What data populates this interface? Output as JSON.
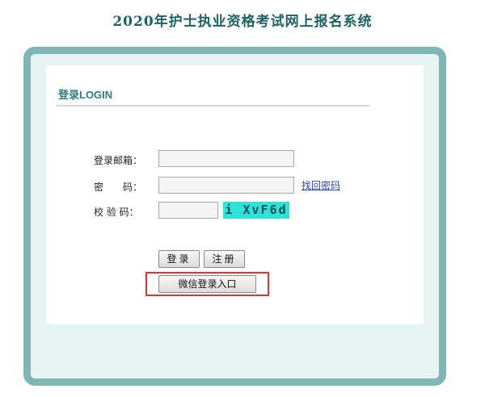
{
  "page": {
    "title": "2020年护士执业资格考试网上报名系统"
  },
  "login_section": {
    "title": "登录LOGIN"
  },
  "form": {
    "email_label": "登录邮箱：",
    "email_value": "",
    "password_label": "密　　码：",
    "password_value": "",
    "captcha_label": "校 验 码：",
    "captcha_value": "",
    "captcha_text": "i XvF6d",
    "forgot_password_link": "找回密码"
  },
  "buttons": {
    "login": "登录",
    "register": "注册",
    "wechat_login": "微信登录入口"
  },
  "colors": {
    "title": "#1f6263",
    "frame_border": "#7fb6b6",
    "frame_background": "#e7f3f2",
    "section_title": "#2c7e7c",
    "captcha_background": "#2ee2dc",
    "highlight": "#e53333",
    "link": "#2a44b8"
  }
}
